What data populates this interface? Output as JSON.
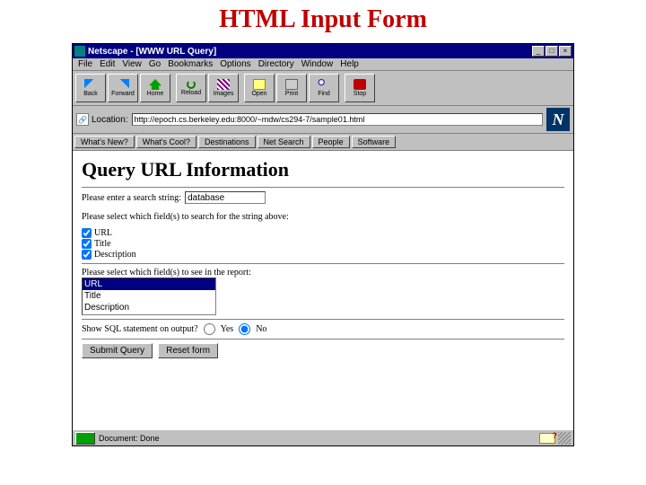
{
  "slide_title": "HTML Input Form",
  "window": {
    "title": "Netscape - [WWW URL Query]",
    "controls": {
      "min": "_",
      "max": "□",
      "close": "×"
    }
  },
  "menu": [
    "File",
    "Edit",
    "View",
    "Go",
    "Bookmarks",
    "Options",
    "Directory",
    "Window",
    "Help"
  ],
  "toolbar": {
    "back": "Back",
    "forward": "Forward",
    "home": "Home",
    "reload": "Reload",
    "images": "Images",
    "open": "Open",
    "print": "Print",
    "find": "Find",
    "stop": "Stop"
  },
  "location": {
    "label": "Location:",
    "value": "http://epoch.cs.berkeley.edu:8000/~mdw/cs294-7/sample01.html"
  },
  "directory": [
    "What's New?",
    "What's Cool?",
    "Destinations",
    "Net Search",
    "People",
    "Software"
  ],
  "page": {
    "heading": "Query URL Information",
    "prompt_search": "Please enter a search string:",
    "search_value": "database",
    "prompt_fields": "Please select which field(s) to search for the string above:",
    "cb_url": "URL",
    "cb_title": "Title",
    "cb_desc": "Description",
    "prompt_report": "Please select which field(s) to see in the report:",
    "list": [
      "URL",
      "Title",
      "Description"
    ],
    "prompt_sql": "Show SQL statement on output?",
    "yes": "Yes",
    "no": "No",
    "submit": "Submit Query",
    "reset": "Reset form"
  },
  "status": {
    "text": "Document: Done"
  }
}
